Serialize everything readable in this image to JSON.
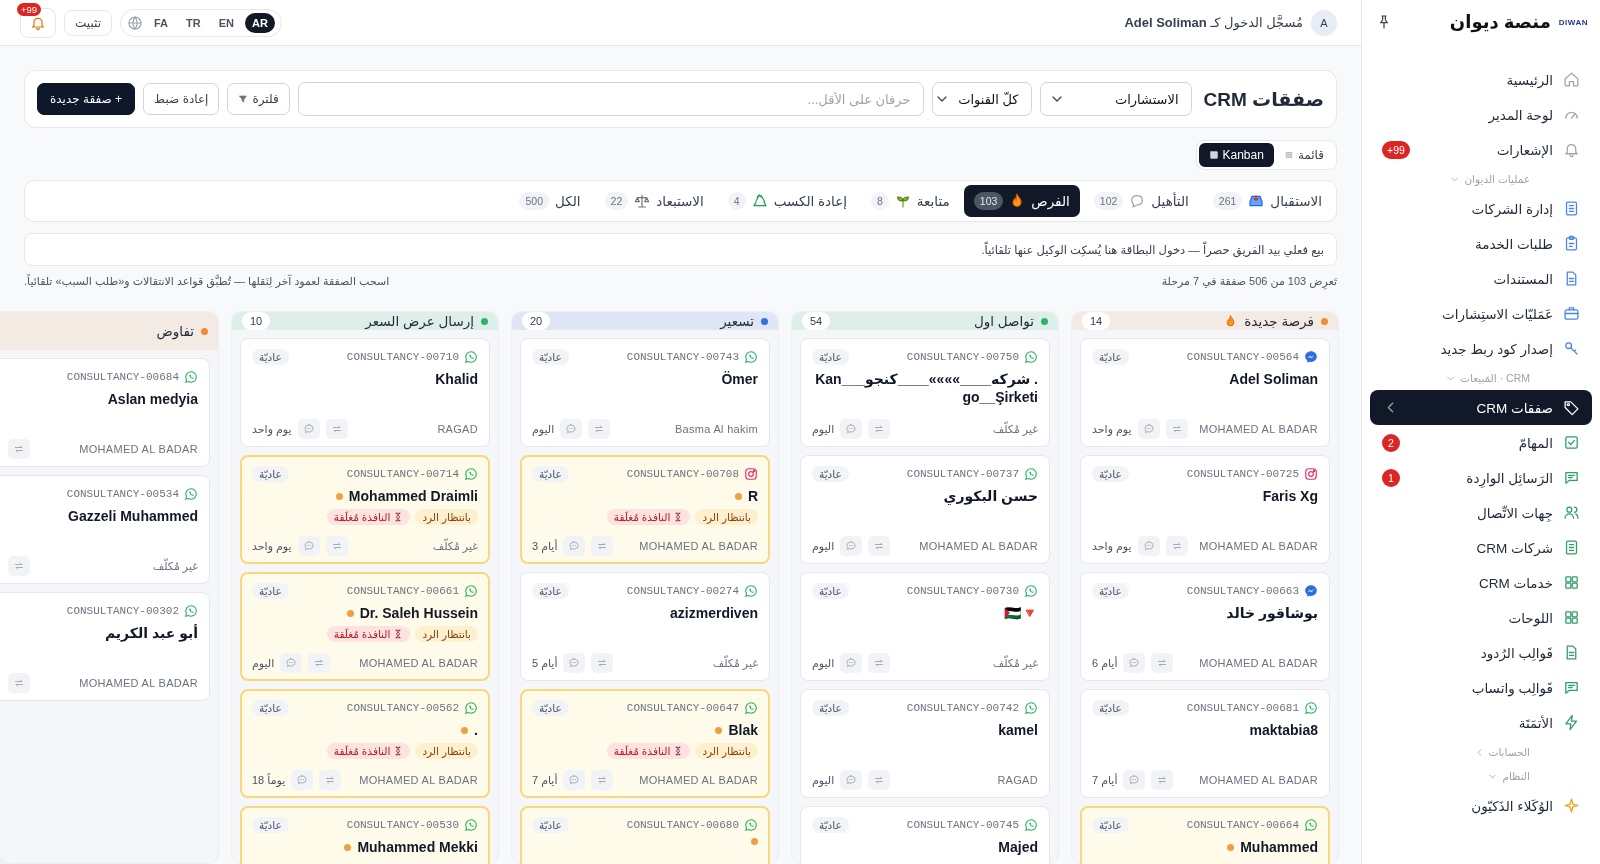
{
  "sidebar": {
    "brand": "منصة ديوان",
    "logo": "DIWAN",
    "top_items": [
      {
        "label": "الرئيسية",
        "kind": "home",
        "selected": false
      },
      {
        "label": "لوحة المدير",
        "kind": "gauge",
        "selected": false
      },
      {
        "label": "الإشعارات",
        "kind": "bell",
        "selected": false,
        "badge": "+99"
      }
    ],
    "groups": [
      {
        "title": "عمليات الديوان",
        "expanded": true,
        "items": [
          {
            "label": "إدارة الشركات",
            "kind": "document",
            "selected": false
          },
          {
            "label": "طلبات الخدمة",
            "kind": "clipboard",
            "selected": false
          },
          {
            "label": "المستندات",
            "kind": "file",
            "selected": false
          },
          {
            "label": "عَمَليّات الاستِشارات",
            "kind": "briefcase",
            "selected": false
          },
          {
            "label": "إصدار كود ربط جديد",
            "kind": "key",
            "selected": false
          }
        ]
      },
      {
        "title": "CRM · المَبيعات",
        "expanded": true,
        "items": [
          {
            "label": "صفقات CRM",
            "kind": "tag",
            "selected": true
          },
          {
            "label": "المهامّ",
            "kind": "checkbox",
            "selected": false,
            "badge": "2"
          },
          {
            "label": "الرَسائِل الوارِدة",
            "kind": "chat",
            "selected": false,
            "badge": "1"
          },
          {
            "label": "جِهات الاتِّصال",
            "kind": "users",
            "selected": false
          },
          {
            "label": "شركات CRM",
            "kind": "document",
            "selected": false
          },
          {
            "label": "خدمات CRM",
            "kind": "grid",
            "selected": false
          },
          {
            "label": "اللوحات",
            "kind": "grid",
            "selected": false
          },
          {
            "label": "قَوالِب الرُدود",
            "kind": "file",
            "selected": false
          },
          {
            "label": "قَوالِب واتساب",
            "kind": "chat",
            "selected": false
          },
          {
            "label": "الأتمَتَة",
            "kind": "bolt",
            "selected": false
          }
        ]
      },
      {
        "title": "الحسابات",
        "expanded": false
      },
      {
        "title": "النظام",
        "expanded": true,
        "items": [
          {
            "label": "الوُكَلاء الذَكيّون",
            "kind": "sparkle",
            "selected": false
          }
        ]
      }
    ]
  },
  "topbar": {
    "avatar": "A",
    "signed_in": "مُسجَّل الدخول كـ **Adel Soliman**",
    "languages": [
      {
        "label": "AR",
        "selected": true
      },
      {
        "label": "EN",
        "selected": false
      },
      {
        "label": "TR",
        "selected": false
      },
      {
        "label": "FA",
        "selected": false
      }
    ],
    "pin_button": "تثبيت",
    "notifications_badge": "+99"
  },
  "header": {
    "title": "صفقات CRM",
    "service_select": "الاستشارات",
    "channel_select": "كلّ القنوات",
    "search": {
      "placeholder": "حرفان على الأقل..."
    },
    "filter_button": "فلترة",
    "reset_button": "إعادة ضبط",
    "new_button": "+ صفقة جديدة"
  },
  "views": [
    {
      "label": "قائمة",
      "kind": "list",
      "selected": false
    },
    {
      "label": "Kanban",
      "kind": "board",
      "selected": true
    }
  ],
  "tabs": [
    {
      "label": "الاستقبال",
      "kind": "tray",
      "count": "261",
      "selected": false
    },
    {
      "label": "التأهيل",
      "kind": "bubble",
      "count": "102",
      "selected": false
    },
    {
      "label": "الفرص",
      "kind": "flame",
      "count": "103",
      "selected": true
    },
    {
      "label": "متابعة",
      "kind": "sprout",
      "count": "8",
      "selected": false
    },
    {
      "label": "إعادة الكسب",
      "kind": "recycle",
      "count": "4",
      "selected": false
    },
    {
      "label": "الاستبعاد",
      "kind": "scales",
      "count": "22",
      "selected": false
    },
    {
      "label": "الكل",
      "count": "500",
      "selected": false
    }
  ],
  "banner": "بيع فعلي بيد الفريق حصراً — دخول البطاقة هنا يُسكِت الوكيل عنها تلقائياً.",
  "summary": "تَعرِض 103 من 506 صفقة في 7 مرحلة",
  "hint": "اسحب الصفقة لعمود آخر لِنَقلها — تُطبَّق قواعد الانتقالات و«طلب السبب» تلقائياً.",
  "columns": [
    {
      "title": "فرصة جديدة",
      "kind": "flame",
      "count": "14",
      "color": "#f08a3c",
      "cards": [
        {
          "id": "CONSULTANCY-00564",
          "kind": "messenger",
          "name": "Adel Soliman",
          "priority": "عاديّة",
          "owner": "MOHAMED AL BADAR",
          "age": "يوم واحد",
          "awaiting": false
        },
        {
          "id": "CONSULTANCY-00725",
          "kind": "instagram",
          "name": "Faris Xg",
          "priority": "عاديّة",
          "owner": "MOHAMED AL BADAR",
          "age": "يوم واحد",
          "awaiting": false
        },
        {
          "id": "CONSULTANCY-00663",
          "kind": "messenger",
          "name": "بوشاقور خالد",
          "priority": "عاديّة",
          "owner": "MOHAMED AL BADAR",
          "age": "أيام 6",
          "awaiting": false
        },
        {
          "id": "CONSULTANCY-00681",
          "kind": "whatsapp",
          "name": "maktabia8",
          "priority": "عاديّة",
          "owner": "MOHAMED AL BADAR",
          "age": "أيام 7",
          "awaiting": false
        },
        {
          "id": "CONSULTANCY-00664",
          "kind": "whatsapp",
          "name": "Muhammed",
          "priority": "عاديّة",
          "awaiting": true
        }
      ]
    },
    {
      "title": "تواصل اول",
      "count": "54",
      "color": "#2fb36a",
      "cards": [
        {
          "id": "CONSULTANCY-00750",
          "kind": "whatsapp",
          "name": ". شركه____»»»»____كنجو___Kango__Şirketi",
          "priority": "عاديّة",
          "owner": "غير مُكلّف",
          "age": "اليوم",
          "awaiting": false
        },
        {
          "id": "CONSULTANCY-00737",
          "kind": "whatsapp",
          "name": "حسن البكوري",
          "priority": "عاديّة",
          "owner": "MOHAMED AL BADAR",
          "age": "اليوم",
          "awaiting": false
        },
        {
          "id": "CONSULTANCY-00730",
          "kind": "whatsapp",
          "name": "🇵🇸🔻",
          "priority": "عاديّة",
          "owner": "غير مُكلّف",
          "age": "اليوم",
          "awaiting": false
        },
        {
          "id": "CONSULTANCY-00742",
          "kind": "whatsapp",
          "name": "kamel",
          "priority": "عاديّة",
          "owner": "RAGAD",
          "age": "اليوم",
          "awaiting": false
        },
        {
          "id": "CONSULTANCY-00745",
          "kind": "whatsapp",
          "name": "Majed",
          "priority": "عاديّة",
          "awaiting": false
        }
      ]
    },
    {
      "title": "تسعير",
      "count": "20",
      "color": "#3b6fe0",
      "cards": [
        {
          "id": "CONSULTANCY-00743",
          "kind": "whatsapp",
          "name": "Ömer",
          "priority": "عاديّة",
          "owner": "Basma Al hakim",
          "age": "اليوم",
          "awaiting": false
        },
        {
          "id": "CONSULTANCY-00708",
          "kind": "instagram",
          "name": "R",
          "priority": "عاديّة",
          "owner": "MOHAMED AL BADAR",
          "age": "أيام 3",
          "awaiting": true,
          "tags": [
            {
              "text": "بانتظار الرد",
              "kind": "waiting"
            },
            {
              "text": "النافذة مُغلَقة",
              "kind": "closed"
            }
          ]
        },
        {
          "id": "CONSULTANCY-00274",
          "kind": "whatsapp",
          "name": "azizmerdiven",
          "priority": "عاديّة",
          "owner": "غير مُكلّف",
          "age": "أيام 5",
          "awaiting": false
        },
        {
          "id": "CONSULTANCY-00647",
          "kind": "whatsapp",
          "name": "Blak",
          "priority": "عاديّة",
          "owner": "MOHAMED AL BADAR",
          "age": "أيام 7",
          "awaiting": true,
          "tags": [
            {
              "text": "بانتظار الرد",
              "kind": "waiting"
            },
            {
              "text": "النافذة مُغلَقة",
              "kind": "closed"
            }
          ]
        },
        {
          "id": "CONSULTANCY-00680",
          "kind": "whatsapp",
          "priority": "عاديّة",
          "awaiting": true
        }
      ]
    },
    {
      "title": "إرسال عرض السعر",
      "count": "10",
      "color": "#2fb36a",
      "cards": [
        {
          "id": "CONSULTANCY-00710",
          "kind": "whatsapp",
          "name": "Khalid",
          "priority": "عاديّة",
          "owner": "RAGAD",
          "age": "يوم واحد",
          "awaiting": false
        },
        {
          "id": "CONSULTANCY-00714",
          "kind": "whatsapp",
          "name": "Mohammed Draimli",
          "priority": "عاديّة",
          "owner": "غير مُكلّف",
          "age": "يوم واحد",
          "awaiting": true,
          "tags": [
            {
              "text": "بانتظار الرد",
              "kind": "waiting"
            },
            {
              "text": "النافذة مُغلَقة",
              "kind": "closed"
            }
          ]
        },
        {
          "id": "CONSULTANCY-00661",
          "kind": "whatsapp",
          "name": "Dr. Saleh Hussein",
          "priority": "عاديّة",
          "owner": "MOHAMED AL BADAR",
          "age": "اليوم",
          "awaiting": true,
          "tags": [
            {
              "text": "بانتظار الرد",
              "kind": "waiting"
            },
            {
              "text": "النافذة مُغلَقة",
              "kind": "closed"
            }
          ]
        },
        {
          "id": "CONSULTANCY-00562",
          "kind": "whatsapp",
          "name": ".",
          "priority": "عاديّة",
          "owner": "MOHAMED AL BADAR",
          "age": "يوماً 18",
          "awaiting": true,
          "tags": [
            {
              "text": "بانتظار الرد",
              "kind": "waiting"
            },
            {
              "text": "النافذة مُغلَقة",
              "kind": "closed"
            }
          ]
        },
        {
          "id": "CONSULTANCY-00530",
          "kind": "whatsapp",
          "name": "Muhammed Mekki",
          "priority": "عاديّة",
          "awaiting": true
        }
      ]
    },
    {
      "title": "تفاوض",
      "color": "#f08a3c",
      "cards": [
        {
          "id": "CONSULTANCY-00684",
          "kind": "whatsapp",
          "name": "Aslan medyia",
          "owner": "MOHAMED AL BADAR",
          "awaiting": false
        },
        {
          "id": "CONSULTANCY-00534",
          "kind": "whatsapp",
          "name": "Gazzeli Muhammed",
          "owner": "غير مُكلّف",
          "awaiting": false
        },
        {
          "id": "CONSULTANCY-00302",
          "kind": "whatsapp",
          "name": "أبو عبد الكريم",
          "owner": "MOHAMED AL BADAR",
          "awaiting": false
        }
      ]
    }
  ]
}
